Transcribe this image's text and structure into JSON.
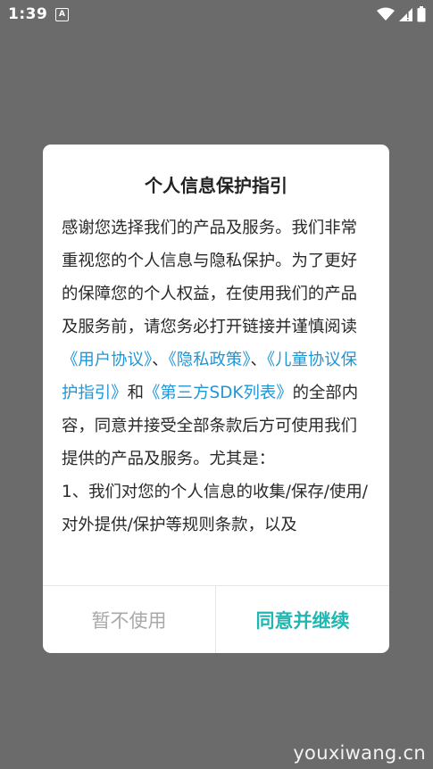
{
  "status_bar": {
    "time": "1:39",
    "notification_glyph": "A",
    "icons": [
      "wifi-icon",
      "signal-icon",
      "battery-icon"
    ]
  },
  "dialog": {
    "title": "个人信息保护指引",
    "body": [
      {
        "type": "text",
        "text": "感谢您选择我们的产品及服务。我们非常重视您的个人信息与隐私保护。为了更好的保障您的个人权益，在使用我们的产品及服务前，请您务必打开链接并谨慎阅读"
      },
      {
        "type": "link",
        "text": "《用户协议》"
      },
      {
        "type": "text",
        "text": "、"
      },
      {
        "type": "link",
        "text": "《隐私政策》"
      },
      {
        "type": "text",
        "text": "、"
      },
      {
        "type": "link",
        "text": "《儿童协议保护指引》"
      },
      {
        "type": "text",
        "text": "和"
      },
      {
        "type": "link",
        "text": "《第三方SDK列表》"
      },
      {
        "type": "text",
        "text": "的全部内容，同意并接受全部条款后方可使用我们提供的产品及服务。尤其是："
      },
      {
        "type": "text",
        "text": "1、我们对您的个人信息的收集/保存/使用/对外提供/保护等规则条款，以及"
      }
    ],
    "decline_label": "暂不使用",
    "agree_label": "同意并继续"
  },
  "watermark": "youxiwang.cn",
  "colors": {
    "overlay": "#6b6b6b",
    "link": "#2196d6",
    "agree": "#1fb7b1",
    "decline": "#a9a9a9"
  }
}
